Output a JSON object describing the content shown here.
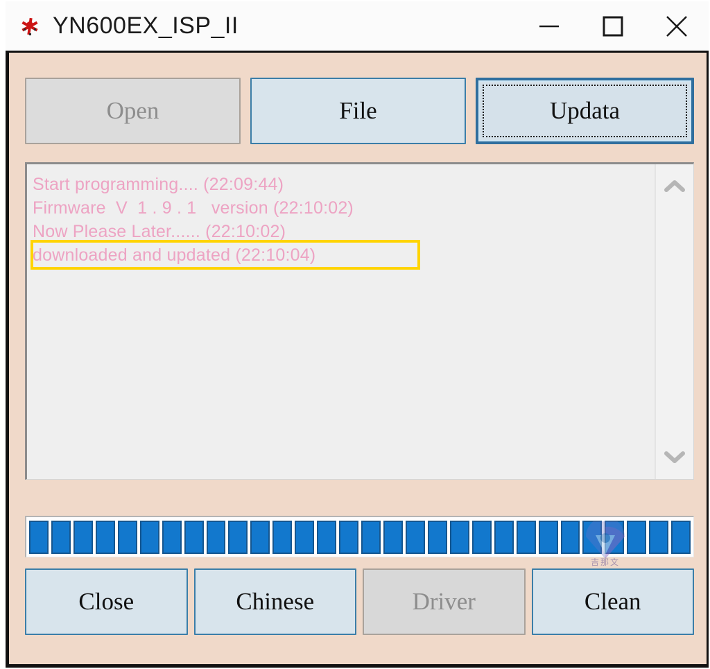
{
  "window": {
    "title": "YN600EX_ISP_II",
    "icon": "red-asterisk-icon",
    "controls": {
      "minimize": "minimize-icon",
      "maximize": "maximize-icon",
      "close": "close-icon"
    },
    "background_color": "#f0d9c9"
  },
  "toolbar": {
    "buttons": [
      {
        "label": "Open",
        "state": "disabled"
      },
      {
        "label": "File",
        "state": "enabled"
      },
      {
        "label": "Updata",
        "state": "focused"
      }
    ]
  },
  "log": {
    "background_color": "#efefef",
    "text_color": "#eda3c3",
    "lines": [
      "Start programming.... (22:09:44)",
      "Firmware  V  1 . 9 . 1   version (22:10:02)",
      "Now Please Later...... (22:10:02)",
      "downloaded and updated (22:10:04)"
    ],
    "highlight": {
      "line_index": 3,
      "color": "#ffd400",
      "annotation": "downloaded and updated (22:10:04)"
    },
    "scrollbar": {
      "up_arrow": "chevron-up-icon",
      "down_arrow": "chevron-down-icon"
    }
  },
  "progress": {
    "percent": 100,
    "segments": 30,
    "fill_color": "#1278cd",
    "border_color": "#15568f"
  },
  "watermark": {
    "text": "吉那文",
    "color": "#7d6a9e"
  },
  "footer": {
    "buttons": [
      {
        "label": "Close",
        "state": "enabled"
      },
      {
        "label": "Chinese",
        "state": "enabled"
      },
      {
        "label": "Driver",
        "state": "disabled"
      },
      {
        "label": "Clean",
        "state": "enabled"
      }
    ]
  }
}
